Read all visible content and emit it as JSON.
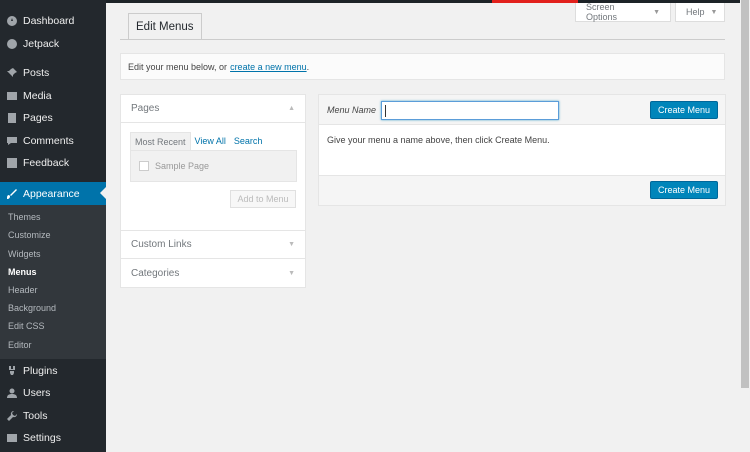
{
  "sidebar": {
    "items": [
      {
        "label": "Dashboard",
        "icon": "dashboard-icon"
      },
      {
        "label": "Jetpack",
        "icon": "jetpack-icon"
      },
      {
        "label": "Posts",
        "icon": "pin-icon"
      },
      {
        "label": "Media",
        "icon": "media-icon"
      },
      {
        "label": "Pages",
        "icon": "pages-icon"
      },
      {
        "label": "Comments",
        "icon": "comment-icon"
      },
      {
        "label": "Feedback",
        "icon": "feedback-icon"
      },
      {
        "label": "Appearance",
        "icon": "brush-icon"
      },
      {
        "label": "Plugins",
        "icon": "plugin-icon"
      },
      {
        "label": "Users",
        "icon": "user-icon"
      },
      {
        "label": "Tools",
        "icon": "wrench-icon"
      },
      {
        "label": "Settings",
        "icon": "settings-icon"
      }
    ],
    "submenu": [
      "Themes",
      "Customize",
      "Widgets",
      "Menus",
      "Header",
      "Background",
      "Edit CSS",
      "Editor"
    ]
  },
  "header": {
    "screen_options": "Screen Options",
    "help": "Help",
    "tab_label": "Edit Menus"
  },
  "manage": {
    "text": "Edit your menu below, or",
    "link": "create a new menu",
    "suffix": "."
  },
  "left_panel": {
    "pages_title": "Pages",
    "tabs": [
      "Most Recent",
      "View All",
      "Search"
    ],
    "sample_item": "Sample Page",
    "add_button": "Add to Menu",
    "custom_links": "Custom Links",
    "categories": "Categories"
  },
  "menu_edit": {
    "name_label": "Menu Name",
    "name_value": "",
    "create_button": "Create Menu",
    "hint": "Give your menu a name above, then click Create Menu."
  },
  "colors": {
    "sidebar_bg": "#23282d",
    "active_bg": "#0073aa",
    "primary_button": "#0085ba"
  }
}
